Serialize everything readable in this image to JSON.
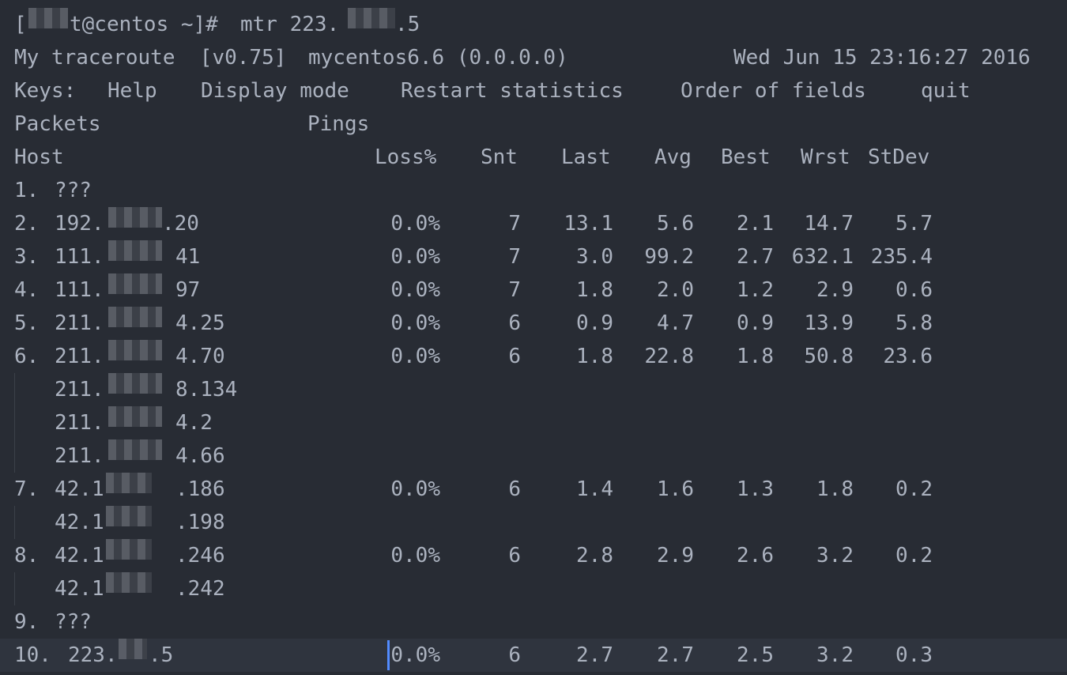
{
  "prompt": {
    "bracket_open": "[",
    "user_host": "t@centos ~]# ",
    "command": "mtr 223.",
    "command_tail": ".5"
  },
  "header": {
    "app_name": "My traceroute  [v0.75]",
    "hostname": "mycentos6.6 (0.0.0.0)",
    "datetime": "Wed Jun 15 23:16:27 2016"
  },
  "keys": {
    "label": "Keys:",
    "help": "Help",
    "display_mode": "Display mode",
    "restart": "Restart statistics",
    "order": "Order of fields",
    "quit": "quit"
  },
  "group_headers": {
    "packets": "Packets",
    "pings": "Pings"
  },
  "columns": {
    "host": "Host",
    "loss": "Loss%",
    "snt": "Snt",
    "last": "Last",
    "avg": "Avg",
    "best": "Best",
    "wrst": "Wrst",
    "stdev": "StDev"
  },
  "hops": [
    {
      "num": "1.",
      "host_pre": "???",
      "host_post": "",
      "loss": "",
      "snt": "",
      "last": "",
      "avg": "",
      "best": "",
      "wrst": "",
      "stdev": ""
    },
    {
      "num": "2.",
      "host_pre": "192.",
      "host_post": ".20",
      "loss": "0.0%",
      "snt": "7",
      "last": "13.1",
      "avg": "5.6",
      "best": "2.1",
      "wrst": "14.7",
      "stdev": "5.7"
    },
    {
      "num": "3.",
      "host_pre": "111.",
      "host_post": "41",
      "loss": "0.0%",
      "snt": "7",
      "last": "3.0",
      "avg": "99.2",
      "best": "2.7",
      "wrst": "632.1",
      "stdev": "235.4"
    },
    {
      "num": "4.",
      "host_pre": "111.",
      "host_post": "97",
      "loss": "0.0%",
      "snt": "7",
      "last": "1.8",
      "avg": "2.0",
      "best": "1.2",
      "wrst": "2.9",
      "stdev": "0.6"
    },
    {
      "num": "5.",
      "host_pre": "211.",
      "host_post": "4.25",
      "loss": "0.0%",
      "snt": "6",
      "last": "0.9",
      "avg": "4.7",
      "best": "0.9",
      "wrst": "13.9",
      "stdev": "5.8"
    },
    {
      "num": "6.",
      "host_pre": "211.",
      "host_post": "4.70",
      "loss": "0.0%",
      "snt": "6",
      "last": "1.8",
      "avg": "22.8",
      "best": "1.8",
      "wrst": "50.8",
      "stdev": "23.6"
    },
    {
      "num": "",
      "host_pre": "211.",
      "host_post": "8.134",
      "loss": "",
      "snt": "",
      "last": "",
      "avg": "",
      "best": "",
      "wrst": "",
      "stdev": ""
    },
    {
      "num": "",
      "host_pre": "211.",
      "host_post": "4.2",
      "loss": "",
      "snt": "",
      "last": "",
      "avg": "",
      "best": "",
      "wrst": "",
      "stdev": ""
    },
    {
      "num": "",
      "host_pre": "211.",
      "host_post": "4.66",
      "loss": "",
      "snt": "",
      "last": "",
      "avg": "",
      "best": "",
      "wrst": "",
      "stdev": ""
    },
    {
      "num": "7.",
      "host_pre": "42.1",
      "host_post": ".186",
      "loss": "0.0%",
      "snt": "6",
      "last": "1.4",
      "avg": "1.6",
      "best": "1.3",
      "wrst": "1.8",
      "stdev": "0.2"
    },
    {
      "num": "",
      "host_pre": "42.1",
      "host_post": ".198",
      "loss": "",
      "snt": "",
      "last": "",
      "avg": "",
      "best": "",
      "wrst": "",
      "stdev": ""
    },
    {
      "num": "8.",
      "host_pre": "42.1",
      "host_post": ".246",
      "loss": "0.0%",
      "snt": "6",
      "last": "2.8",
      "avg": "2.9",
      "best": "2.6",
      "wrst": "3.2",
      "stdev": "0.2"
    },
    {
      "num": "",
      "host_pre": "42.1",
      "host_post": ".242",
      "loss": "",
      "snt": "",
      "last": "",
      "avg": "",
      "best": "",
      "wrst": "",
      "stdev": ""
    },
    {
      "num": "9.",
      "host_pre": "???",
      "host_post": "",
      "loss": "",
      "snt": "",
      "last": "",
      "avg": "",
      "best": "",
      "wrst": "",
      "stdev": ""
    },
    {
      "num": "10.",
      "host_pre": "223.",
      "host_post": ".5",
      "loss": "0.0%",
      "snt": "6",
      "last": "2.7",
      "avg": "2.7",
      "best": "2.5",
      "wrst": "3.2",
      "stdev": "0.3"
    }
  ],
  "colors": {
    "background": "#282c34",
    "foreground": "#abb2bf",
    "cursor": "#528bff",
    "active_row": "#2f343e"
  }
}
